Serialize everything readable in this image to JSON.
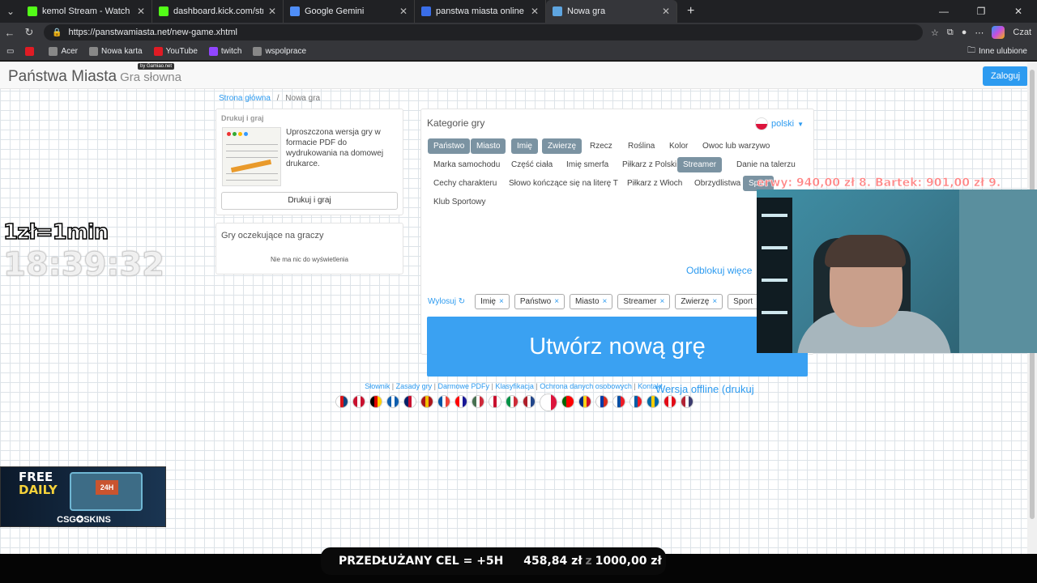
{
  "browser": {
    "tabs": [
      {
        "title": "kemol Stream - Watch Live on Kick",
        "color": "#53fc18",
        "active": false
      },
      {
        "title": "dashboard.kick.com/stream",
        "color": "#53fc18",
        "active": false
      },
      {
        "title": "Google Gemini",
        "color": "#4f8ef7",
        "active": false
      },
      {
        "title": "panstwa miasta online - Wyszukaj",
        "color": "#3a6ee8",
        "active": false
      },
      {
        "title": "Nowa gra",
        "color": "#5ea5e0",
        "active": true
      }
    ],
    "url": "https://panstwamiasta.net/new-game.xhtml",
    "bookmarks": [
      {
        "label": "",
        "color": "#e01b24"
      },
      {
        "label": "Acer",
        "color": "#888"
      },
      {
        "label": "Nowa karta",
        "color": "#888"
      },
      {
        "label": "YouTube",
        "color": "#e01b24"
      },
      {
        "label": "twitch",
        "color": "#9146ff"
      },
      {
        "label": "wspolprace",
        "color": "#888"
      }
    ],
    "bookmarks_right": "Inne ulubione",
    "copilot_label": "Czat"
  },
  "site": {
    "brand": "Państwa Miasta",
    "brand_sub": "Gra słowna",
    "by": "by Gamiao.net",
    "login": "Zaloguj",
    "breadcrumb_home": "Strona główna",
    "breadcrumb_current": "Nowa gra",
    "print_panel": {
      "header": "Drukuj i graj",
      "desc": "Uproszczona wersja gry w formacie PDF do wydrukowania na domowej drukarce.",
      "button": "Drukuj i graj"
    },
    "waiting_panel": {
      "header": "Gry oczekujące na graczy",
      "empty": "Nie ma nic do wyświetlenia"
    },
    "categories_panel": {
      "header": "Kategorie gry",
      "language": "polski",
      "categories": [
        {
          "label": "Państwo",
          "selected": true
        },
        {
          "label": "Miasto",
          "selected": true
        },
        {
          "label": "Imię",
          "selected": true
        },
        {
          "label": "Zwierzę",
          "selected": true
        },
        {
          "label": "Rzecz",
          "selected": false
        },
        {
          "label": "Roślina",
          "selected": false
        },
        {
          "label": "Kolor",
          "selected": false
        },
        {
          "label": "Owoc lub warzywo",
          "selected": false
        },
        {
          "label": "Marka samochodu",
          "selected": false
        },
        {
          "label": "Część ciała",
          "selected": false
        },
        {
          "label": "Imię smerfa",
          "selected": false
        },
        {
          "label": "Piłkarz z Polski",
          "selected": false
        },
        {
          "label": "Streamer",
          "selected": true
        },
        {
          "label": "Danie na talerzu",
          "selected": false
        },
        {
          "label": "Cechy charakteru",
          "selected": false
        },
        {
          "label": "Słowo kończące się na literę T",
          "selected": false
        },
        {
          "label": "Piłkarz z Włoch",
          "selected": false
        },
        {
          "label": "Obrzydlistwa",
          "selected": false
        },
        {
          "label": "Sport",
          "selected": true
        },
        {
          "label": "Klub Sportowy",
          "selected": false
        }
      ],
      "unlock": "Odblokuj więce",
      "draw": "Wylosuj",
      "chips": [
        "Imię",
        "Państwo",
        "Miasto",
        "Streamer",
        "Zwierzę",
        "Sport"
      ],
      "create": "Utwórz nową grę",
      "offline": "Wersja offline (drukuj"
    },
    "footer_links": [
      "Słownik",
      "Zasady gry",
      "Darmowe PDFy",
      "Klasyfikacja",
      "Ochrona danych osobowych",
      "Kontakt"
    ]
  },
  "overlay": {
    "rate": "1zł=1min",
    "clock": "18:39:32",
    "ticker": "erwy: 940,00 zł   8. Bartek: 901,00 zł   9.",
    "promo_free": "FREE",
    "promo_daily": "DAILY",
    "promo_case": "24H",
    "promo_brand": "CSG✪SKINS",
    "goal_label": "PRZEDŁUŻANY CEL = +5H",
    "goal_current": "458,84 zł",
    "goal_sep": "z",
    "goal_target": "1000,00 zł"
  },
  "colors": {
    "accent": "#2d9bf0",
    "selected_cat": "#7b93a2",
    "create_btn": "#3aa1f2"
  }
}
